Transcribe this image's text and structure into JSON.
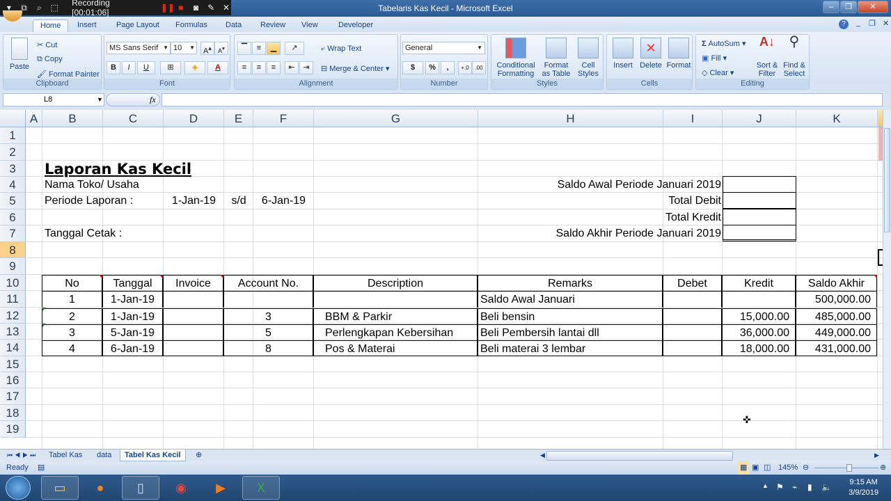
{
  "recorder": {
    "label": "Recording [00:01:06]"
  },
  "window": {
    "title": "Tabelaris Kas Kecil - Microsoft Excel"
  },
  "ribbon_tabs": [
    "Home",
    "Insert",
    "Page Layout",
    "Formulas",
    "Data",
    "Review",
    "View",
    "Developer"
  ],
  "clipboard": {
    "paste": "Paste",
    "cut": "Cut",
    "copy": "Copy",
    "format_painter": "Format Painter",
    "label": "Clipboard"
  },
  "font": {
    "name": "MS Sans Serif",
    "size": "10",
    "label": "Font",
    "bold": "B",
    "italic": "I",
    "underline": "U"
  },
  "alignment": {
    "wrap_text": "Wrap Text",
    "merge_center": "Merge & Center",
    "label": "Alignment"
  },
  "number": {
    "format": "General",
    "currency": "$",
    "percent": "%",
    "comma": ",",
    "label": "Number"
  },
  "styles": {
    "conditional": "Conditional Formatting",
    "format_table": "Format as Table",
    "cell_styles": "Cell Styles",
    "label": "Styles"
  },
  "cells": {
    "insert": "Insert",
    "delete": "Delete",
    "format": "Format",
    "label": "Cells"
  },
  "editing": {
    "autosum": "AutoSum",
    "fill": "Fill",
    "clear": "Clear",
    "sort": "Sort & Filter",
    "find": "Find & Select",
    "label": "Editing"
  },
  "formula_bar": {
    "name_box": "L8",
    "fx": "fx",
    "value": ""
  },
  "columns": [
    "A",
    "B",
    "C",
    "D",
    "E",
    "F",
    "G",
    "H",
    "I",
    "J",
    "K"
  ],
  "rows": [
    "1",
    "2",
    "3",
    "4",
    "5",
    "6",
    "7",
    "8",
    "9",
    "10",
    "11",
    "12",
    "13",
    "14",
    "15",
    "16",
    "17",
    "18",
    "19"
  ],
  "report": {
    "title": "Laporan Kas Kecil",
    "nama_toko": "Nama Toko/ Usaha",
    "periode_label": "Periode Laporan :",
    "periode_start": "1-Jan-19",
    "periode_sd": "s/d",
    "periode_end": "6-Jan-19",
    "tanggal_cetak": "Tanggal Cetak :",
    "saldo_awal": "Saldo Awal Periode Januari 2019",
    "total_debit": "Total Debit",
    "total_kredit": "Total Kredit",
    "saldo_akhir": "Saldo Akhir Periode Januari 2019"
  },
  "table": {
    "headers": [
      "No",
      "Tanggal",
      "Invoice",
      "Account No.",
      "Description",
      "Remarks",
      "Debet",
      "Kredit",
      "Saldo Akhir"
    ],
    "rows": [
      [
        "1",
        "1-Jan-19",
        "",
        "",
        "",
        "Saldo Awal Januari",
        "",
        "",
        "500,000.00"
      ],
      [
        "2",
        "1-Jan-19",
        "",
        "3",
        "BBM & Parkir",
        "Beli bensin",
        "",
        "15,000.00",
        "485,000.00"
      ],
      [
        "3",
        "5-Jan-19",
        "",
        "5",
        "Perlengkapan Kebersihan",
        "Beli Pembersih lantai dll",
        "",
        "36,000.00",
        "449,000.00"
      ],
      [
        "4",
        "6-Jan-19",
        "",
        "8",
        "Pos & Materai",
        "Beli materai 3 lembar",
        "",
        "18,000.00",
        "431,000.00"
      ]
    ]
  },
  "sheets": [
    "Tabel Kas",
    "data",
    "Tabel Kas Kecil"
  ],
  "active_sheet": "Tabel Kas Kecil",
  "status": {
    "ready": "Ready",
    "zoom": "145%"
  },
  "clock": {
    "time": "9:15 AM",
    "date": "3/9/2019"
  }
}
